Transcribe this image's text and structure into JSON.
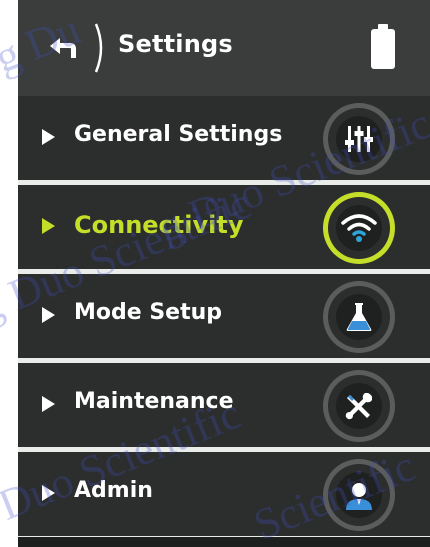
{
  "header": {
    "title": "Settings",
    "back_icon": "back-arrow-icon",
    "battery_icon": "battery-icon"
  },
  "menu": {
    "items": [
      {
        "label": "General Settings",
        "icon": "sliders-icon",
        "active": false
      },
      {
        "label": "Connectivity",
        "icon": "wifi-icon",
        "active": true
      },
      {
        "label": "Mode Setup",
        "icon": "flask-icon",
        "active": false
      },
      {
        "label": "Maintenance",
        "icon": "tools-icon",
        "active": false
      },
      {
        "label": "Admin",
        "icon": "user-icon",
        "active": false
      }
    ]
  },
  "colors": {
    "accent": "#c4de2a",
    "background": "#2b2e2c",
    "header": "#3a3d3b",
    "divider": "#e9ece9",
    "icon_blue": "#3a8fd9"
  },
  "watermark": {
    "lines": [
      "g Du",
      "g Duo Scientific",
      "g Duo Scientific",
      "g Duo Scientific",
      "Scientific"
    ]
  }
}
